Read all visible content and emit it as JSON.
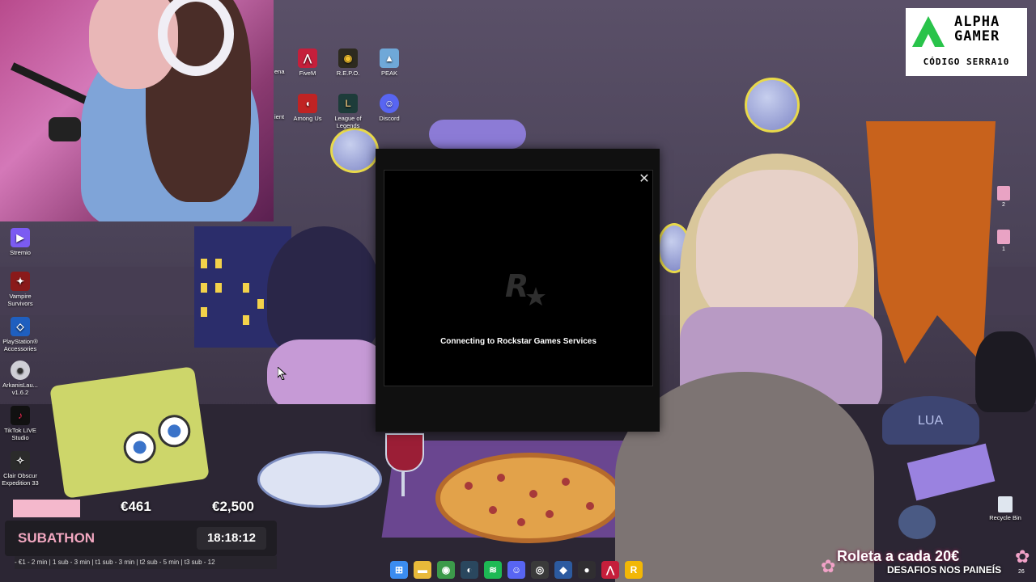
{
  "desktop": {
    "top_icons": [
      {
        "label": "FiveM",
        "icon": "fivem-icon",
        "color": "#c51f3b"
      },
      {
        "label": "R.E.P.O.",
        "icon": "repo-icon",
        "color": "#2d2a1f"
      },
      {
        "label": "PEAK",
        "icon": "peak-icon",
        "color": "#6fa8d8"
      },
      {
        "label": "Among Us",
        "icon": "among-us-icon",
        "color": "#c02323"
      },
      {
        "label": "League of Legends",
        "icon": "league-of-legends-icon",
        "color": "#1d3c3a"
      },
      {
        "label": "Discord",
        "icon": "discord-icon",
        "color": "#5865f2"
      }
    ],
    "cut_labels": [
      "ena",
      "ient"
    ],
    "left_icons": [
      {
        "label": "Stremio",
        "icon": "stremio-icon",
        "color": "#7b5bf2"
      },
      {
        "label": "Vampire Survivors",
        "icon": "vampire-survivors-icon",
        "color": "#8a1a1a"
      },
      {
        "label": "PlayStation® Accessories",
        "icon": "playstation-accessories-icon",
        "color": "#1f5fbf"
      },
      {
        "label": "ArkanisLau... v1.6.2",
        "icon": "arkanis-launcher-icon",
        "color": "#cfcfd6"
      },
      {
        "label": "TikTok LIVE Studio",
        "icon": "tiktok-live-studio-icon",
        "color": "#111111"
      },
      {
        "label": "Clair Obscur Expedition 33",
        "icon": "clair-obscur-icon",
        "color": "#2b2b2b"
      }
    ],
    "right_icons": [
      {
        "label": "2",
        "icon": "file-icon-2"
      },
      {
        "label": "1",
        "icon": "file-icon-1"
      }
    ],
    "recycle_bin": {
      "label": "Recycle Bin",
      "icon": "recycle-bin-icon"
    }
  },
  "dialog": {
    "logo": "rockstar-logo-icon",
    "status_text": "Connecting to Rockstar Games Services",
    "close_glyph": "✕"
  },
  "sponsor": {
    "brand_line1": "ALPHA",
    "brand_line2": "GAMER",
    "code_text": "CÓDIGO SERRA10",
    "accent": "#29c34a"
  },
  "subathon": {
    "current_amount": "€461",
    "goal_amount": "€2,500",
    "progress": 0.184,
    "title": "SUBATHON",
    "timer": "18:18:12",
    "ticker": "- €1 - 2 min | 1 sub - 3 min | t1 sub - 3 min | t2 sub - 5 min | t3 sub - 12",
    "accent": "#f2a7c0"
  },
  "overlay": {
    "roleta_text": "Roleta a cada 20€",
    "desafios_text": "DESAFIOS NOS PAINEÍS",
    "corner_number": "26"
  },
  "taskbar": {
    "apps": [
      {
        "name": "start-button",
        "glyph": "⊞",
        "color": "#3b8cf0"
      },
      {
        "name": "file-explorer-icon",
        "glyph": "▬",
        "color": "#e8b93a"
      },
      {
        "name": "chrome-icon",
        "glyph": "◉",
        "color": "#3c9a4a"
      },
      {
        "name": "steam-icon",
        "glyph": "◐",
        "color": "#2a475e"
      },
      {
        "name": "spotify-icon",
        "glyph": "≋",
        "color": "#1db954"
      },
      {
        "name": "discord-taskbar-icon",
        "glyph": "☺",
        "color": "#5865f2"
      },
      {
        "name": "gamepad-icon",
        "glyph": "◎",
        "color": "#3a3a3a"
      },
      {
        "name": "vpn-icon",
        "glyph": "◆",
        "color": "#2c5aa0"
      },
      {
        "name": "obs-icon",
        "glyph": "●",
        "color": "#302e31"
      },
      {
        "name": "fivem-taskbar-icon",
        "glyph": "⋀",
        "color": "#c51f3b"
      },
      {
        "name": "rockstar-launcher-icon",
        "glyph": "R",
        "color": "#f2b705"
      }
    ]
  }
}
